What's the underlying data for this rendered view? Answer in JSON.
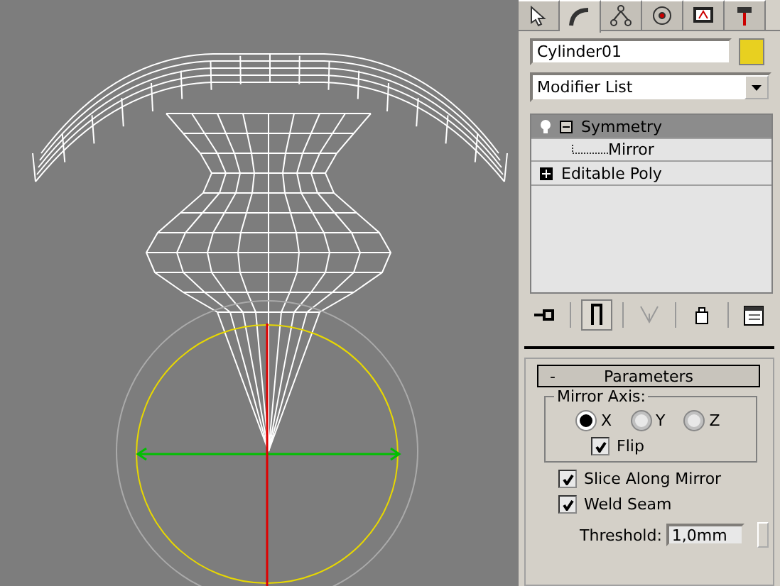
{
  "command_tabs": [
    {
      "selected": false
    },
    {
      "selected": true
    },
    {
      "selected": false
    },
    {
      "selected": false
    },
    {
      "selected": false
    },
    {
      "selected": false
    }
  ],
  "object": {
    "name": "Cylinder01",
    "color": "#e8d020"
  },
  "modifier_list": {
    "label": "Modifier List"
  },
  "modifier_stack": [
    {
      "label": "Symmetry",
      "selected": true,
      "expanded": true,
      "children": [
        {
          "label": "Mirror",
          "selected": false
        }
      ]
    },
    {
      "label": "Editable Poly",
      "selected": false,
      "expanded": false
    }
  ],
  "stack_toolbar": [
    {
      "kind": "pin",
      "on": false,
      "disabled": false
    },
    {
      "kind": "end-result",
      "on": true,
      "disabled": false
    },
    {
      "kind": "unique",
      "on": false,
      "disabled": true
    },
    {
      "kind": "remove",
      "on": false,
      "disabled": false
    },
    {
      "kind": "configure",
      "on": false,
      "disabled": false
    }
  ],
  "rollout": {
    "sign": "-",
    "title": "Parameters",
    "mirror_axis": {
      "label": "Mirror Axis:",
      "options": [
        {
          "label": "X",
          "selected": true
        },
        {
          "label": "Y",
          "selected": false
        },
        {
          "label": "Z",
          "selected": false
        }
      ],
      "flip": {
        "label": "Flip",
        "checked": true
      }
    },
    "slice_along_mirror": {
      "label": "Slice Along Mirror",
      "checked": true
    },
    "weld_seam": {
      "label": "Weld Seam",
      "checked": true
    },
    "threshold": {
      "label": "Threshold:",
      "value": "1,0mm"
    }
  }
}
